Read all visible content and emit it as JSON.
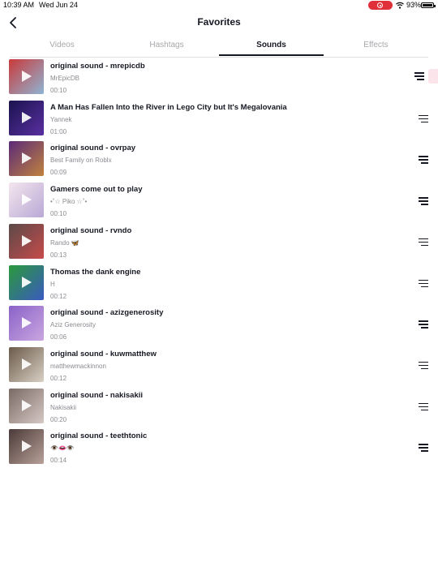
{
  "status_bar": {
    "time": "10:39 AM",
    "date": "Wed Jun 24",
    "battery": "93%",
    "record_color": "#e0303a"
  },
  "header": {
    "title": "Favorites",
    "back_icon": "chevron-left-icon"
  },
  "tabs": [
    {
      "label": "Videos",
      "active": false
    },
    {
      "label": "Hashtags",
      "active": false
    },
    {
      "label": "Sounds",
      "active": true
    },
    {
      "label": "Effects",
      "active": false
    }
  ],
  "sounds": [
    {
      "title": "original sound - mrepicdb",
      "author": "MrEpicDB",
      "duration": "00:10",
      "thumb_colors": [
        "#c93a3a",
        "#8fb4d4"
      ]
    },
    {
      "title": "A Man Has Fallen Into the River in Lego City but It's Megalovania",
      "author": "Yannek",
      "duration": "01:00",
      "thumb_colors": [
        "#1a1450",
        "#5a2fa0"
      ]
    },
    {
      "title": "original sound - ovrpay",
      "author": "Best Family on Roblx",
      "duration": "00:09",
      "thumb_colors": [
        "#5b2a78",
        "#c0823e"
      ]
    },
    {
      "title": "Gamers come out to play",
      "author": "•˚☆ Piko ☆˚•",
      "duration": "00:10",
      "thumb_colors": [
        "#f4e6ee",
        "#b9a8d6"
      ]
    },
    {
      "title": "original sound - rvndo",
      "author": "Rando 🦋",
      "duration": "00:13",
      "thumb_colors": [
        "#5a4a48",
        "#c84b4b"
      ]
    },
    {
      "title": "Thomas the dank engine",
      "author": "H",
      "duration": "00:12",
      "thumb_colors": [
        "#2a9a3a",
        "#3a5ac0"
      ]
    },
    {
      "title": "original sound - azizgenerosity",
      "author": "Aziz Generosity",
      "duration": "00:06",
      "thumb_colors": [
        "#8a62c8",
        "#caa6e0"
      ]
    },
    {
      "title": "original sound - kuwmatthew",
      "author": "matthewmackinnon",
      "duration": "00:12",
      "thumb_colors": [
        "#6b5a4a",
        "#d8d0c4"
      ]
    },
    {
      "title": "original sound - nakisakii",
      "author": "Nakisakii",
      "duration": "00:20",
      "thumb_colors": [
        "#7a6a66",
        "#d6c8c4"
      ]
    },
    {
      "title": "original sound - teethtonic",
      "author": "👁️👄👁️",
      "duration": "00:14",
      "thumb_colors": [
        "#4a3a38",
        "#b8a098"
      ]
    }
  ],
  "icons": {
    "play": "play-icon",
    "menu": "playlist-menu-icon"
  }
}
